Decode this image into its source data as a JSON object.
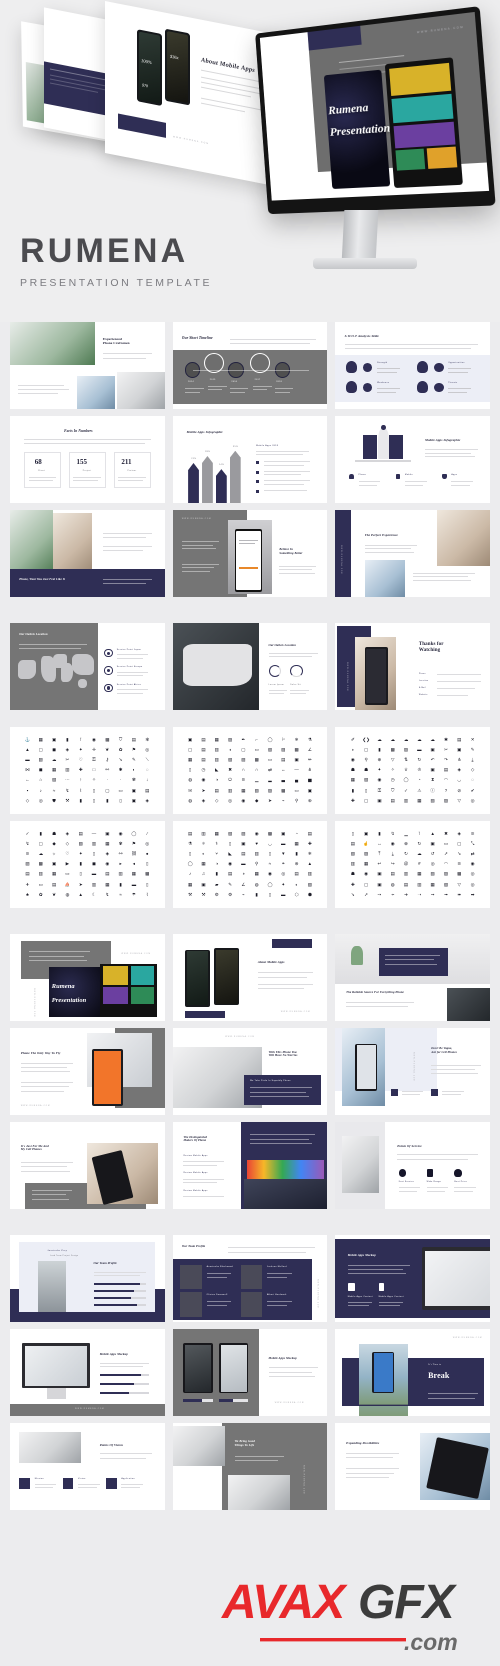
{
  "brand": {
    "title": "RUMENA",
    "subtitle": "PRESENTATION TEMPLATE",
    "website": "WWW.RUMENA.COM",
    "hero_slide_title_line1": "Rumena",
    "hero_slide_title_line2": "Presentation",
    "hero_float_title_1": "With This Phone You",
    "hero_float_title_2": "Will Have No Worries",
    "hero_float_title_3": "About Mobile Apps",
    "hero_float_navy_text": "We Take Pride In Superb Crafted Phones",
    "hero_phone_stat_1": "100%",
    "hero_phone_stat_2": "$78",
    "hero_phone_stat_3": "$36x"
  },
  "colors": {
    "navy": "#2f2e55",
    "gray": "#757575",
    "lavender": "#eceef6",
    "page_bg": "#ececee",
    "watermark_red": "#e8282b",
    "watermark_dark": "#3c3c3c"
  },
  "watermark": {
    "avax": "AVAX",
    "gfx": "GFX",
    "dotcom": ".com"
  },
  "sections": [
    {
      "name": "infographic-slides",
      "slides": [
        {
          "id": "experienced-phone-craftsmen",
          "title": "Experienced\nPhone Craftsmen",
          "layout": "image-left-text-right"
        },
        {
          "id": "our-short-timeline",
          "title": "Our Short Timeline",
          "layout": "timeline",
          "steps": [
            {
              "label": "2014",
              "caption": "Lorem ipsum dolor sit amet consectetur"
            },
            {
              "label": "2015",
              "caption": "Lorem ipsum dolor sit amet consectetur"
            },
            {
              "label": "2016",
              "caption": "Lorem ipsum dolor sit amet consectetur"
            },
            {
              "label": "2017",
              "caption": "Lorem ipsum dolor sit amet consectetur"
            },
            {
              "label": "2018",
              "caption": "Lorem ipsum dolor sit amet consectetur"
            }
          ]
        },
        {
          "id": "swot-analysis-slide",
          "title": "S.W.O.T Analysis Slide",
          "layout": "swot",
          "items": [
            {
              "letter": "S",
              "label": "Strength"
            },
            {
              "letter": "O",
              "label": "Opportunities"
            },
            {
              "letter": "W",
              "label": "Weakness"
            },
            {
              "letter": "T",
              "label": "Threats"
            }
          ]
        },
        {
          "id": "facts-in-numbers",
          "title": "Facts In Numbers",
          "layout": "stats",
          "stats": [
            {
              "value": "68",
              "label": "Client"
            },
            {
              "value": "155",
              "label": "Project"
            },
            {
              "value": "211",
              "label": "Partner"
            }
          ]
        },
        {
          "id": "mobile-apps-infographic-bars",
          "title": "Mobile Apps Infographic",
          "layout": "bar-chart",
          "legend_title": "Mobile Apps 2018",
          "bars": [
            {
              "label": "21%",
              "value": 21,
              "color": "#2f2e55"
            },
            {
              "label": "28%",
              "value": 28,
              "color": "#9a9a9e"
            },
            {
              "label": "14%",
              "value": 14,
              "color": "#2f2e55"
            },
            {
              "label": "35%",
              "value": 35,
              "color": "#9a9a9e"
            }
          ],
          "bullets": [
            "Lorem ipsum dolor sit amet",
            "Consectetur adipiscing elit",
            "Sed do eiusmod tempor",
            "Incididunt ut labore"
          ]
        },
        {
          "id": "mobile-apps-infographic-rocket",
          "title": "Mobile Apps Infographic",
          "layout": "rocket",
          "features": [
            {
              "label": "Phone"
            },
            {
              "label": "Mobile"
            },
            {
              "label": "Apps"
            }
          ]
        },
        {
          "id": "phone-wear-you-just-feel-like-it",
          "title": "Phone, Wear You Just Feel Like It",
          "layout": "image-collage-navy"
        },
        {
          "id": "believe-in-something-better",
          "title": "Believe In\nSomething Better",
          "layout": "gray-phone-mockup"
        },
        {
          "id": "the-perfect-experience",
          "title": "The Perfect Experience",
          "layout": "navy-bar-images"
        }
      ]
    },
    {
      "name": "location-and-closing",
      "slides": [
        {
          "id": "our-outlets-location-world",
          "title": "Our Outlets Location",
          "layout": "world-map",
          "points": [
            {
              "label": "Service Point Japan"
            },
            {
              "label": "Service Point Europe"
            },
            {
              "label": "Service Point Africa"
            }
          ]
        },
        {
          "id": "our-outlets-location-usa",
          "title": "Our Outlets Location",
          "layout": "usa-map-donuts",
          "donuts": [
            {
              "label": "Lorem Ipsum",
              "value": 70
            },
            {
              "label": "Dolor Sit",
              "value": 55
            }
          ]
        },
        {
          "id": "thanks-for-watching",
          "title": "Thanks for\nWatching",
          "layout": "closing",
          "contacts": [
            {
              "key": "Phone",
              "value": "+12 345 678 9000"
            },
            {
              "key": "Location",
              "value": "1234 Street Name, City, Country"
            },
            {
              "key": "E-Mail",
              "value": "hello@rumena.com"
            },
            {
              "key": "Website",
              "value": "www.rumena.com"
            }
          ]
        }
      ]
    },
    {
      "name": "icon-sheets",
      "slides": [
        {
          "id": "icon-sheet-1",
          "rows": 7,
          "cols": 10
        },
        {
          "id": "icon-sheet-2",
          "rows": 7,
          "cols": 10
        },
        {
          "id": "icon-sheet-3",
          "rows": 7,
          "cols": 10
        },
        {
          "id": "icon-sheet-4",
          "rows": 7,
          "cols": 10
        },
        {
          "id": "icon-sheet-5",
          "rows": 7,
          "cols": 10
        },
        {
          "id": "icon-sheet-6",
          "rows": 7,
          "cols": 10
        }
      ]
    },
    {
      "name": "mockup-slides",
      "slides": [
        {
          "id": "rumena-presentation-cover",
          "title": "Rumena\nPresentation",
          "layout": "cover-phone"
        },
        {
          "id": "about-mobile-apps",
          "title": "About Mobile Apps",
          "layout": "two-phones-text"
        },
        {
          "id": "the-reliable-source-for-everything-phone",
          "title": "The Reliable Source For Everything Phone",
          "layout": "desk-monitor"
        },
        {
          "id": "phone-the-only-way-to-fly",
          "title": "Phone The Only Way To Fly",
          "layout": "hand-phone-right"
        },
        {
          "id": "with-this-phone-you-will-have-no-worries",
          "title": "With This Phone You\nWill Have No Worries",
          "layout": "desk-navy-card",
          "card_title": "We Take Pride In Superbly Phone"
        },
        {
          "id": "dont-be-vague-ask-for-cell-phones",
          "title": "Don't Be Vague,\nAsk for Cell Phones",
          "layout": "person-phone-left",
          "features": [
            {
              "label": "Lorem Ipsum Dolor"
            },
            {
              "label": "Sit Amet Consect"
            }
          ]
        },
        {
          "id": "its-just-for-me-and-my-cell-phones",
          "title": "It's Just For Me And\nMy Cell Phones",
          "layout": "gray-block-phone"
        },
        {
          "id": "the-distinguished-makers-of-phone",
          "title": "The Distinguished\nMakers Of Phone",
          "layout": "navy-laptop",
          "list": [
            {
              "label": "Review Mobile Apps"
            },
            {
              "label": "Review Mobile Apps"
            },
            {
              "label": "Review Mobile Apps"
            }
          ]
        },
        {
          "id": "points-of-service",
          "title": "Points Of Service",
          "layout": "three-icons",
          "items": [
            {
              "label": "Fast Service"
            },
            {
              "label": "Wide Range"
            },
            {
              "label": "Best Price"
            }
          ]
        }
      ]
    },
    {
      "name": "team-and-mockups",
      "slides": [
        {
          "id": "our-team-profile-single",
          "title": "Our Team Profile",
          "layout": "single-member",
          "member_name": "Anastasha Grey",
          "member_role": "Lead Team Project Design",
          "skills": [
            {
              "label": "Design",
              "value": 90
            },
            {
              "label": "Branding",
              "value": 80
            },
            {
              "label": "Marketing",
              "value": 75
            },
            {
              "label": "Research",
              "value": 85
            }
          ]
        },
        {
          "id": "our-team-profile-grid",
          "title": "Our Team Profile",
          "layout": "member-grid",
          "members": [
            {
              "name": "Anastasha Blackwood",
              "role": "Creative Director"
            },
            {
              "name": "Jackson Mulford",
              "role": "Project Lead"
            },
            {
              "name": "Oliviea Dawnwell",
              "role": "Marketing Head"
            },
            {
              "name": "Albert Hardwork",
              "role": "Lead Developer"
            }
          ]
        },
        {
          "id": "mobile-apps-mockup-tablet",
          "title": "Mobile Apps Mockup",
          "layout": "navy-tablet",
          "features": [
            {
              "label": "Mobile Apps Content"
            },
            {
              "label": "Mobile Apps Content"
            }
          ]
        },
        {
          "id": "mobile-apps-mockup-desktop",
          "title": "Mobile Apps Mockup",
          "layout": "desktop-bars",
          "bars": [
            {
              "value": 85
            },
            {
              "value": 70
            },
            {
              "value": 60
            }
          ]
        },
        {
          "id": "mobile-apps-mockup-phones",
          "title": "Mobile Apps Mockup",
          "layout": "gray-two-phones",
          "bars": [
            {
              "value": 62
            },
            {
              "value": 48
            }
          ]
        },
        {
          "id": "its-time-to-break",
          "title": "Break",
          "eyebrow": "It's Time to",
          "layout": "break-slide",
          "sub1": "Individual commitment to a group effort that is what",
          "sub2": "makes a team work, a company work, a society work"
        },
        {
          "id": "points-of-vision",
          "title": "Points Of Vision",
          "layout": "vision-icons",
          "items": [
            {
              "label": "Mission"
            },
            {
              "label": "Vision"
            },
            {
              "label": "Application"
            }
          ]
        },
        {
          "id": "we-bring-good-things-to-life",
          "title": "We Bring Good\nThings To Life",
          "layout": "gray-desk"
        },
        {
          "id": "expanding-possibilities",
          "title": "Expanding Possibilities",
          "layout": "phone-right-text"
        }
      ]
    }
  ]
}
